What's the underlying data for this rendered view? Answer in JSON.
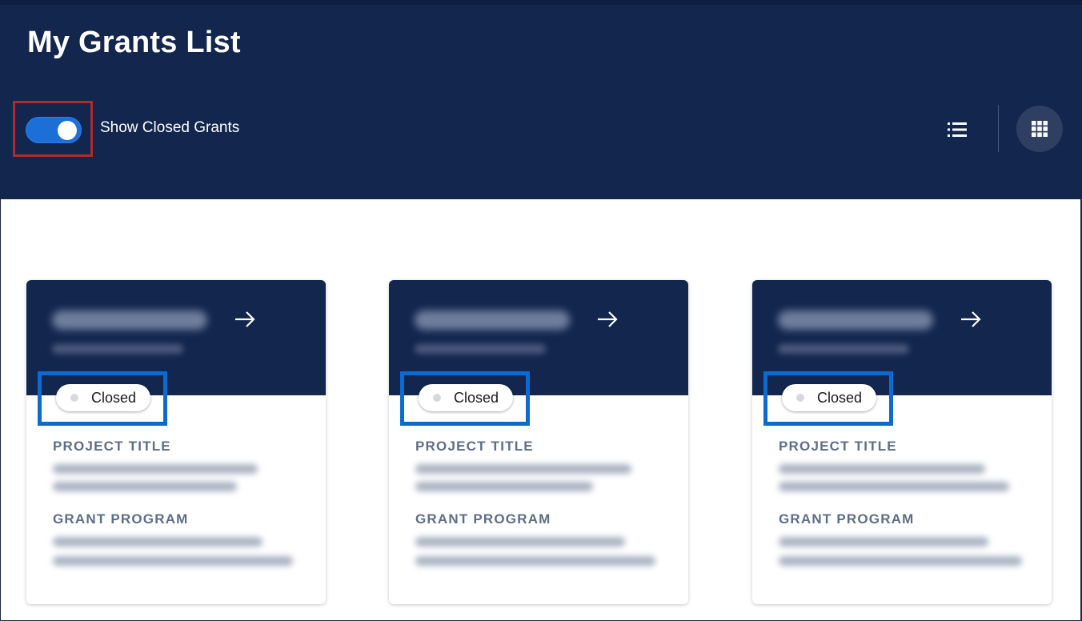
{
  "header": {
    "title": "My Grants List",
    "toggle": {
      "label": "Show Closed Grants",
      "on": true
    },
    "view_buttons": {
      "list_icon": "list-view-icon",
      "grid_icon": "grid-view-icon",
      "active": "grid"
    }
  },
  "cards": [
    {
      "status": "Closed",
      "project_title_label": "PROJECT TITLE",
      "grant_program_label": "GRANT PROGRAM",
      "arrow_icon": "arrow-right-icon"
    },
    {
      "status": "Closed",
      "project_title_label": "PROJECT TITLE",
      "grant_program_label": "GRANT PROGRAM",
      "arrow_icon": "arrow-right-icon"
    },
    {
      "status": "Closed",
      "project_title_label": "PROJECT TITLE",
      "grant_program_label": "GRANT PROGRAM",
      "arrow_icon": "arrow-right-icon"
    }
  ],
  "colors": {
    "header_bg": "#12264e",
    "toggle_on": "#1b6fd6",
    "highlight_red": "#b02a2e",
    "highlight_blue": "#0b6bd0",
    "label_gray": "#5d6e87"
  }
}
